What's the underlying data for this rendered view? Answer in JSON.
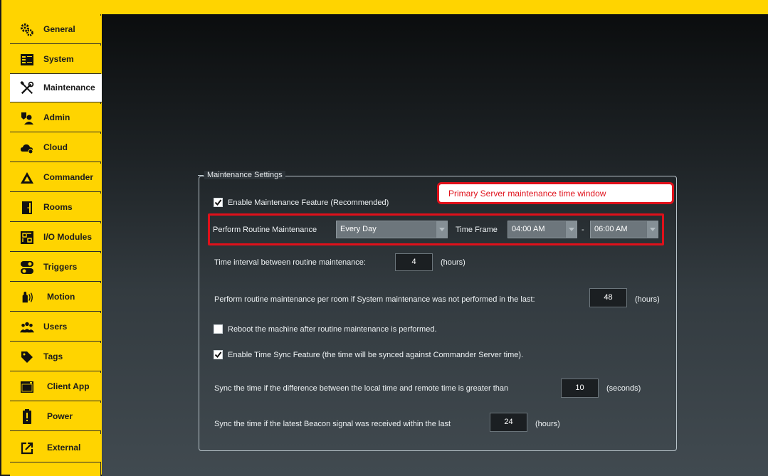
{
  "sidebar": {
    "items": [
      {
        "label": "General",
        "icon": "gears-icon"
      },
      {
        "label": "System",
        "icon": "server-icon"
      },
      {
        "label": "Maintenance",
        "icon": "tools-icon",
        "active": true
      },
      {
        "label": "Admin",
        "icon": "admin-icon"
      },
      {
        "label": "Cloud",
        "icon": "cloud-icon"
      },
      {
        "label": "Commander",
        "icon": "commander-logo-icon"
      },
      {
        "label": "Rooms",
        "icon": "door-icon"
      },
      {
        "label": "I/O Modules",
        "icon": "io-module-icon"
      },
      {
        "label": "Triggers",
        "icon": "toggle-icon"
      },
      {
        "label": "Motion",
        "icon": "motion-hand-icon"
      },
      {
        "label": "Users",
        "icon": "users-icon"
      },
      {
        "label": "Tags",
        "icon": "tag-icon"
      },
      {
        "label": "Client App",
        "icon": "window-icon"
      },
      {
        "label": "Power",
        "icon": "battery-icon"
      },
      {
        "label": "External",
        "icon": "external-link-icon"
      }
    ]
  },
  "maintenance": {
    "legend": "Maintenance Settings",
    "enable_label": "Enable Maintenance Feature (Recommended)",
    "enable_checked": true,
    "routine_label": "Perform Routine Maintenance",
    "routine_value": "Every Day",
    "timeframe_label": "Time Frame",
    "timeframe_start": "04:00 AM",
    "timeframe_separator": "-",
    "timeframe_end": "06:00 AM",
    "interval_label": "Time interval between routine maintenance:",
    "interval_value": "4",
    "interval_unit": "(hours)",
    "room_label": "Perform routine maintenance per room if System maintenance was not performed in the last:",
    "room_value": "48",
    "room_unit": "(hours)",
    "reboot_label": "Reboot the machine after routine maintenance is performed.",
    "reboot_checked": false,
    "timesync_label": "Enable Time Sync Feature (the time will be synced against Commander Server time).",
    "timesync_checked": true,
    "sync_diff_label": "Sync the time if the difference between the local time and remote time is greater than",
    "sync_diff_value": "10",
    "sync_diff_unit": "(seconds)",
    "beacon_label": "Sync the time if the latest Beacon signal was received within the last",
    "beacon_value": "24",
    "beacon_unit": "(hours)"
  },
  "callout": {
    "text": "Primary Server maintenance time window"
  },
  "colors": {
    "accent": "#ffd400",
    "highlight": "#e0101a"
  }
}
